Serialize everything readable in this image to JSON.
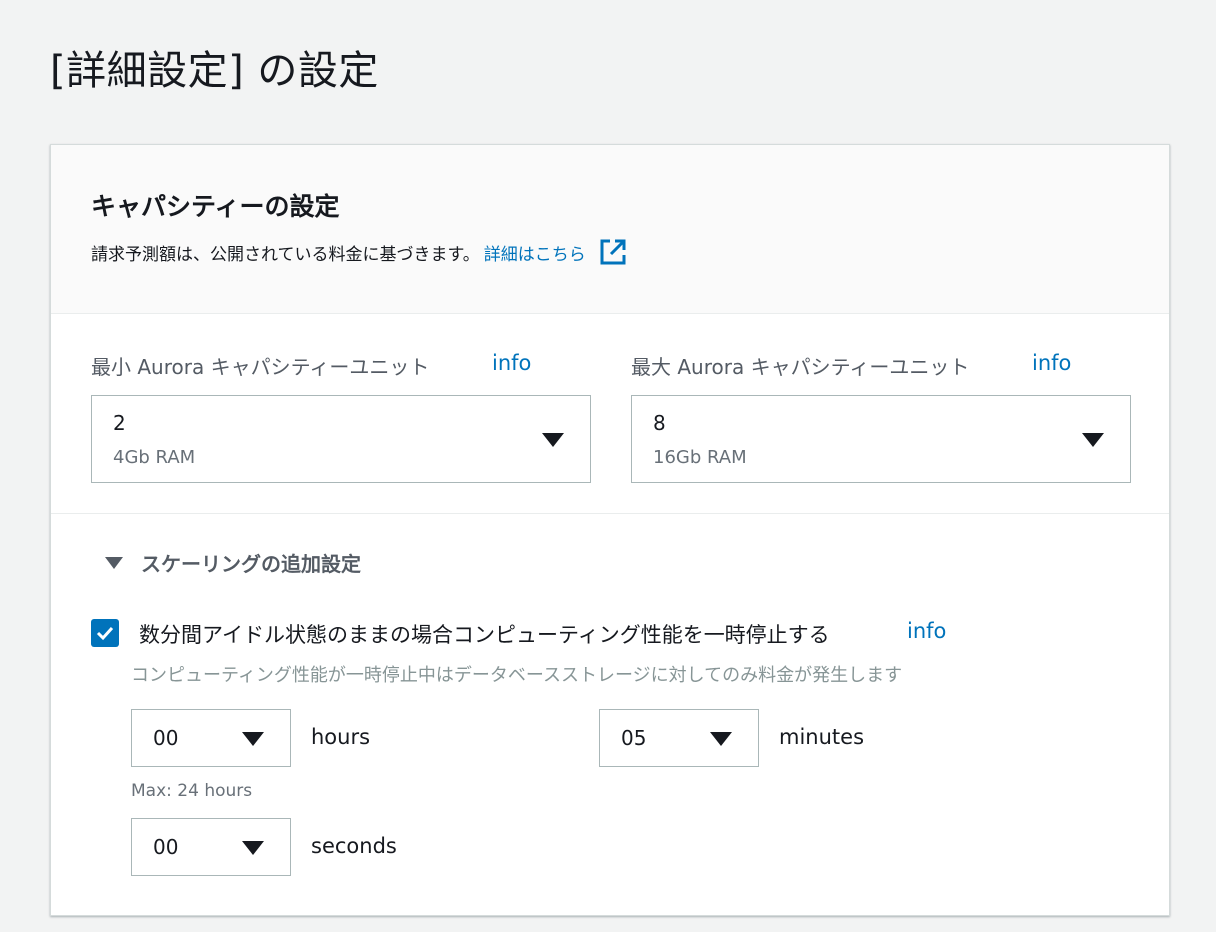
{
  "page": {
    "title": "[詳細設定] の設定"
  },
  "capacity": {
    "title": "キャパシティーの設定",
    "description": "請求予測額は、公開されている料金に基づきます。",
    "learn_more": "詳細はこちら",
    "min": {
      "label": "最小 Aurora キャパシティーユニット",
      "info": "info",
      "value": "2",
      "sub": "4Gb RAM"
    },
    "max": {
      "label": "最大 Aurora キャパシティーユニット",
      "info": "info",
      "value": "8",
      "sub": "16Gb RAM"
    }
  },
  "scaling": {
    "title": "スケーリングの追加設定",
    "pause": {
      "checked": true,
      "label": "数分間アイドル状態のままの場合コンピューティング性能を一時停止する",
      "info": "info",
      "description": "コンピューティング性能が一時停止中はデータベースストレージに対してのみ料金が発生します"
    },
    "hours": {
      "value": "00",
      "unit": "hours",
      "hint": "Max: 24 hours"
    },
    "minutes": {
      "value": "05",
      "unit": "minutes"
    },
    "seconds": {
      "value": "00",
      "unit": "seconds"
    }
  },
  "colors": {
    "link": "#0073bb",
    "checkbox": "#0073bb",
    "background": "#f2f3f3"
  }
}
